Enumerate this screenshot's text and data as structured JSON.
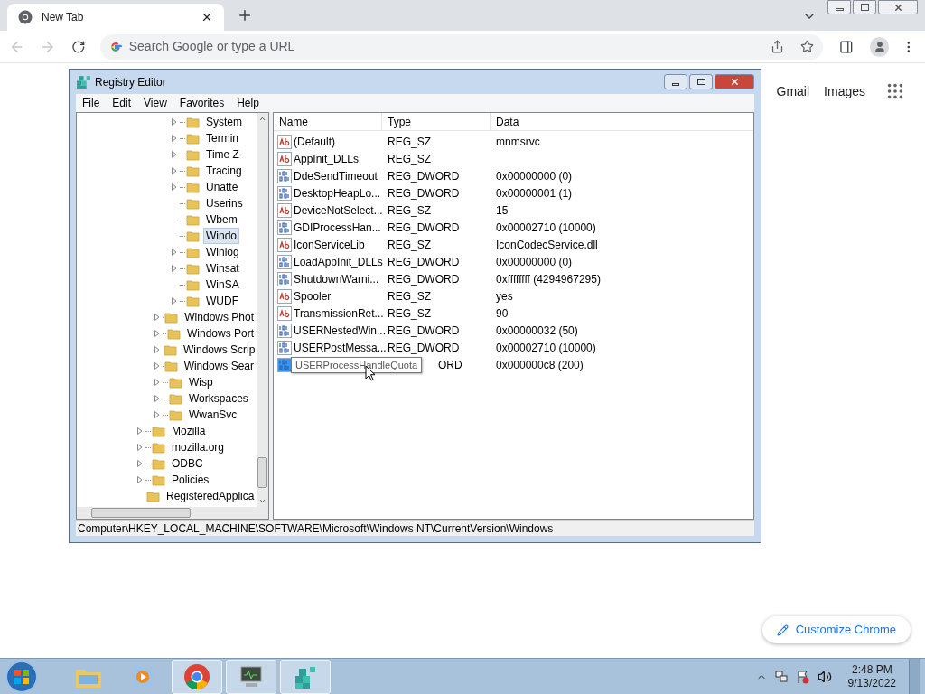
{
  "browser": {
    "tab": {
      "title": "New Tab",
      "selected": true
    },
    "omnibox": {
      "placeholder": "Search Google or type a URL"
    },
    "back_enabled": false,
    "forward_enabled": false
  },
  "page": {
    "links": [
      "Gmail",
      "Images"
    ],
    "customize_button": "Customize Chrome"
  },
  "regedit": {
    "title": "Registry Editor",
    "menu": [
      "File",
      "Edit",
      "View",
      "Favorites",
      "Help"
    ],
    "tree": [
      {
        "children": [
          {
            "children": [
              {
                "label": "System",
                "expandable": true,
                "selected": false
              },
              {
                "label": "Termin",
                "expandable": true,
                "selected": false
              },
              {
                "label": "Time Z",
                "expandable": true,
                "selected": false
              },
              {
                "label": "Tracing",
                "expandable": true,
                "selected": false
              },
              {
                "label": "Unatte",
                "expandable": true,
                "selected": false
              },
              {
                "label": "Userins",
                "expandable": false,
                "selected": false
              },
              {
                "label": "Wbem",
                "expandable": false,
                "selected": false
              },
              {
                "label": "Windo",
                "expandable": false,
                "selected": true
              },
              {
                "label": "Winlog",
                "expandable": true,
                "selected": false
              },
              {
                "label": "Winsat",
                "expandable": true,
                "selected": false
              },
              {
                "label": "WinSA",
                "expandable": false,
                "selected": false
              },
              {
                "label": "WUDF",
                "expandable": true,
                "selected": false
              }
            ]
          },
          {
            "label": "Windows Phot",
            "expandable": true,
            "selected": false
          },
          {
            "label": "Windows Port",
            "expandable": true,
            "selected": false
          },
          {
            "label": "Windows Scrip",
            "expandable": true,
            "selected": false
          },
          {
            "label": "Windows Sear",
            "expandable": true,
            "selected": false
          },
          {
            "label": "Wisp",
            "expandable": true,
            "selected": false
          },
          {
            "label": "Workspaces",
            "expandable": true,
            "selected": false
          },
          {
            "label": "WwanSvc",
            "expandable": true,
            "selected": false
          }
        ]
      },
      {
        "label": "Mozilla",
        "expandable": true,
        "selected": false
      },
      {
        "label": "mozilla.org",
        "expandable": true,
        "selected": false
      },
      {
        "label": "ODBC",
        "expandable": true,
        "selected": false
      },
      {
        "label": "Policies",
        "expandable": true,
        "selected": false
      },
      {
        "label": "RegisteredApplica",
        "expandable": false,
        "selected": false
      }
    ],
    "columns": [
      "Name",
      "Type",
      "Data"
    ],
    "rows": [
      {
        "kind": "string",
        "name": "(Default)",
        "type": "REG_SZ",
        "data": "mnmsrvc",
        "selected": false
      },
      {
        "kind": "string",
        "name": "AppInit_DLLs",
        "type": "REG_SZ",
        "selected": false
      },
      {
        "kind": "dword",
        "name": "DdeSendTimeout",
        "type": "REG_DWORD",
        "data": "0x00000000 (0)",
        "selected": false
      },
      {
        "kind": "dword",
        "name": "DesktopHeapLo...",
        "type": "REG_DWORD",
        "data": "0x00000001 (1)",
        "selected": false
      },
      {
        "kind": "string",
        "name": "DeviceNotSelect...",
        "type": "REG_SZ",
        "data": "15",
        "selected": false
      },
      {
        "kind": "dword",
        "name": "GDIProcessHan...",
        "type": "REG_DWORD",
        "data": "0x00002710 (10000)",
        "selected": false
      },
      {
        "kind": "string",
        "name": "IconServiceLib",
        "type": "REG_SZ",
        "data": "IconCodecService.dll",
        "selected": false
      },
      {
        "kind": "dword",
        "name": "LoadAppInit_DLLs",
        "type": "REG_DWORD",
        "data": "0x00000000 (0)",
        "selected": false
      },
      {
        "kind": "dword",
        "name": "ShutdownWarni...",
        "type": "REG_DWORD",
        "data": "0xffffffff (4294967295)",
        "selected": false
      },
      {
        "kind": "string",
        "name": "Spooler",
        "type": "REG_SZ",
        "data": "yes",
        "selected": false
      },
      {
        "kind": "string",
        "name": "TransmissionRet...",
        "type": "REG_SZ",
        "data": "90",
        "selected": false
      },
      {
        "kind": "dword",
        "name": "USERNestedWin...",
        "type": "REG_DWORD",
        "data": "0x00000032 (50)",
        "selected": false
      },
      {
        "kind": "dword",
        "name": "USERPostMessa...",
        "type": "REG_DWORD",
        "data": "0x00002710 (10000)",
        "selected": false
      },
      {
        "kind": "dword",
        "type": "ORD",
        "data": "0x000000c8 (200)",
        "selected": true
      }
    ],
    "tooltip": "USERProcessHandleQuota",
    "status": "Computer\\HKEY_LOCAL_MACHINE\\SOFTWARE\\Microsoft\\Windows NT\\CurrentVersion\\Windows"
  },
  "taskbar": {
    "apps": [
      {
        "kind": "explorer",
        "active": false
      },
      {
        "kind": "media",
        "active": false
      },
      {
        "kind": "chrome",
        "active": true
      },
      {
        "kind": "monitor",
        "active": true
      },
      {
        "kind": "regedit",
        "active": true
      }
    ],
    "time": "2:48 PM",
    "date": "9/13/2022"
  }
}
